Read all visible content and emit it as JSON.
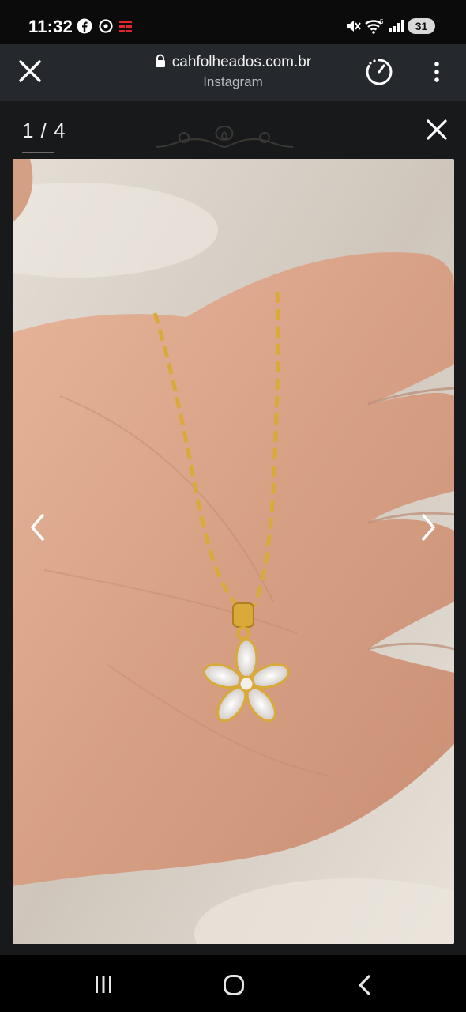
{
  "status_bar": {
    "time": "11:32",
    "battery": "31",
    "icons": [
      "facebook-icon",
      "media-icon",
      "notification-app-icon",
      "mute-icon",
      "wifi-icon",
      "signal-icon",
      "battery-icon"
    ]
  },
  "browser": {
    "domain": "cahfolheados.com.br",
    "subtitle": "Instagram",
    "icons": [
      "close-icon",
      "lock-icon",
      "speed-icon",
      "more-icon"
    ]
  },
  "viewer": {
    "counter": "1 / 4",
    "icons": [
      "close-icon",
      "chevron-left-icon",
      "chevron-right-icon"
    ]
  },
  "nav": {
    "icons": [
      "recents-icon",
      "home-icon",
      "back-icon"
    ]
  },
  "colors": {
    "status_bg": "#0b0b0c",
    "toolbar_bg": "#25282c",
    "viewer_bg": "#17191a",
    "gold": "#d9a93a",
    "skin": "#d9a78c"
  }
}
